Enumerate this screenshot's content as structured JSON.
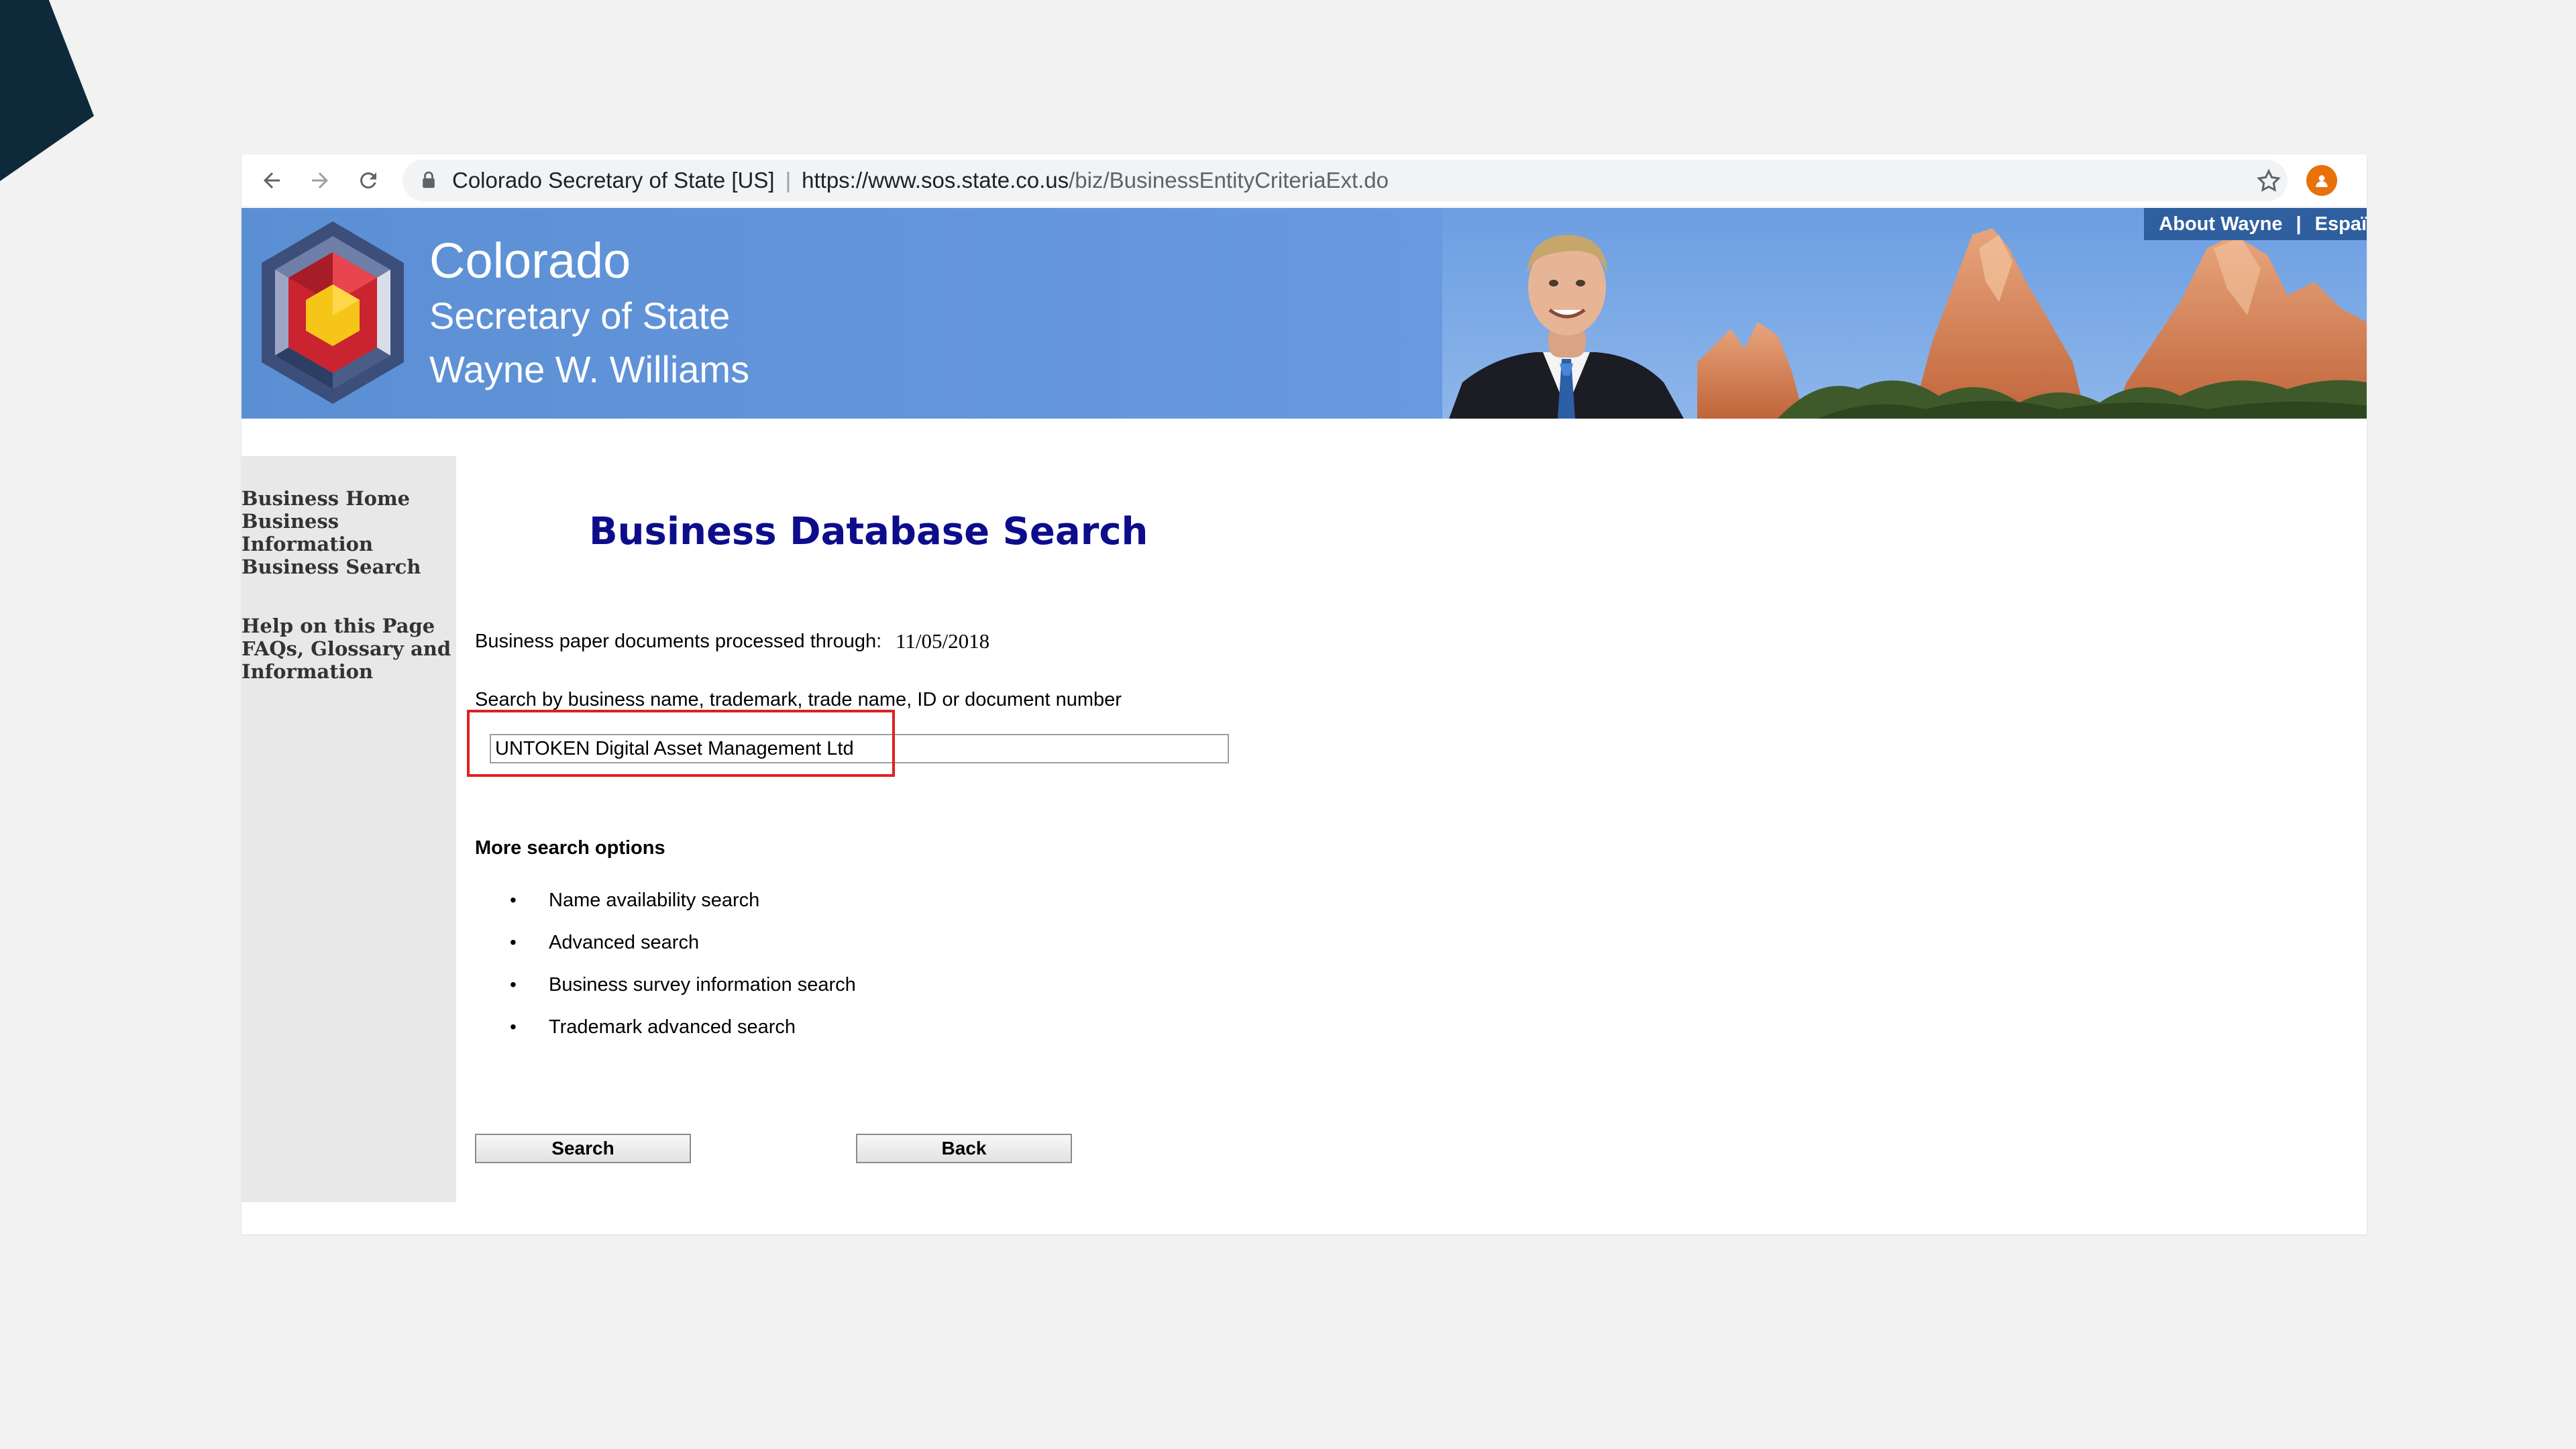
{
  "browser": {
    "site_name": "Colorado Secretary of State [US]",
    "separator": "|",
    "url_domain": "https://www.sos.state.co.us",
    "url_path": "/biz/BusinessEntityCriteriaExt.do"
  },
  "banner": {
    "line1": "Colorado",
    "line2": "Secretary of State",
    "line3": "Wayne W. Williams",
    "link_about": "About Wayne",
    "link_pipe": "|",
    "link_espanol": "Espaï"
  },
  "sidebar": {
    "group1": [
      "Business Home",
      "Business Information",
      "Business Search"
    ],
    "group2": [
      "Help on this Page",
      "FAQs, Glossary and Information"
    ]
  },
  "main": {
    "title": "Business Database Search",
    "processed_label": "Business paper documents processed through:",
    "processed_date": "11/05/2018",
    "search_label": "Search by business name, trademark, trade name, ID or document number",
    "search_value": "UNTOKEN Digital Asset Management Ltd",
    "more_options_title": "More search options",
    "options": [
      "Name availability search",
      "Advanced search",
      "Business survey information search",
      "Trademark advanced search"
    ],
    "search_button": "Search",
    "back_button": "Back"
  },
  "colors": {
    "banner_blue": "#5b8fd4",
    "title_navy": "#0d0d8c",
    "highlight_red": "#e02020"
  }
}
